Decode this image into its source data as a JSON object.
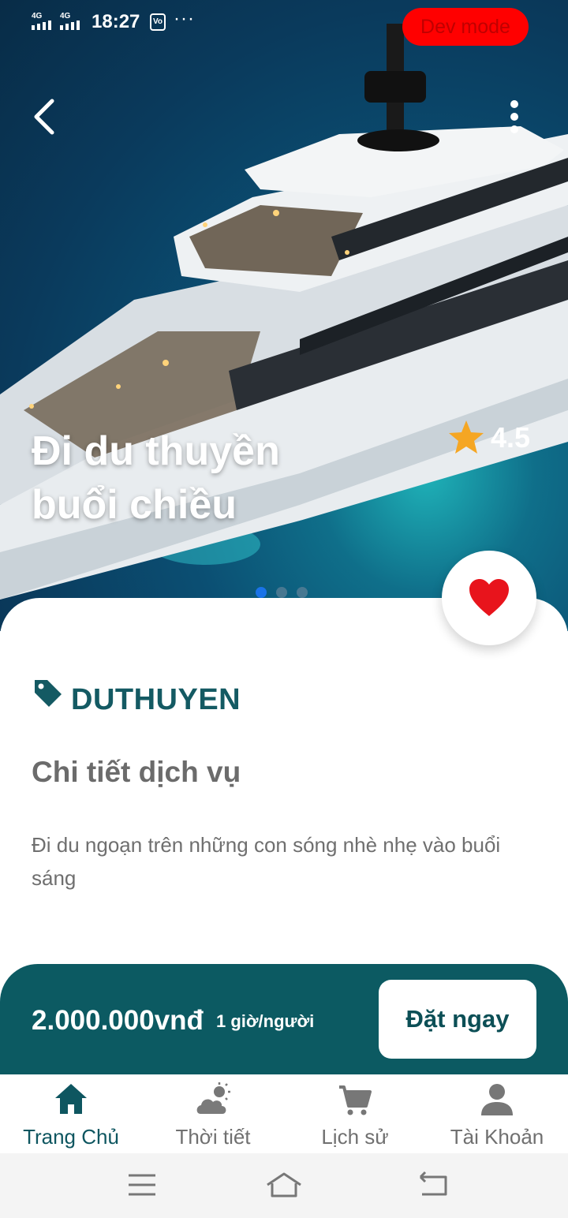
{
  "status_bar": {
    "network_1": "4G",
    "network_2": "4G",
    "time": "18:27",
    "sim_label": "Vo",
    "more": "···",
    "dev_badge": "Dev mode"
  },
  "header": {
    "back_icon": "chevron-left-icon",
    "menu_icon": "more-vertical-icon"
  },
  "hero": {
    "title": "Đi du thuyền buổi chiều",
    "rating": "4.5",
    "rating_icon": "star-icon",
    "star_color": "#f5a623"
  },
  "detail": {
    "favorite_icon": "heart-icon",
    "favorite_color": "#e8141c",
    "tag_icon": "tag-icon",
    "category": "DUTHUYEN",
    "section_title": "Chi tiết dịch vụ",
    "description": "Đi du ngoạn trên những con sóng nhè nhẹ vào buổi sáng"
  },
  "booking": {
    "price": "2.000.000vnđ",
    "unit": "1 giờ/người",
    "book_label": "Đặt ngay",
    "bar_color": "#0c5a62"
  },
  "bottom_nav": {
    "items": [
      {
        "label": "Trang Chủ",
        "icon": "home-icon",
        "active": true
      },
      {
        "label": "Thời tiết",
        "icon": "weather-icon",
        "active": false
      },
      {
        "label": "Lịch sử",
        "icon": "cart-icon",
        "active": false
      },
      {
        "label": "Tài Khoản",
        "icon": "user-icon",
        "active": false
      }
    ]
  },
  "system_nav": {
    "menu_icon": "menu-icon",
    "home_icon": "home-outline-icon",
    "back_icon": "back-icon"
  }
}
